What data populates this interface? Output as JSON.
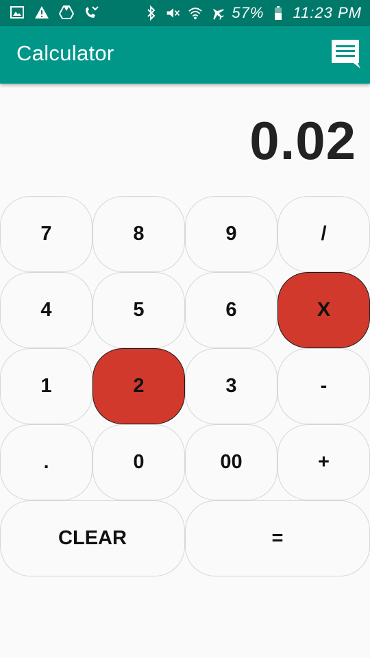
{
  "status_bar": {
    "battery": "57%",
    "time": "11:23 PM",
    "left_icons": [
      "gallery-icon",
      "warning-icon",
      "drive-icon",
      "missed-call-icon"
    ],
    "right_icons": [
      "bluetooth-icon",
      "mute-icon",
      "wifi-icon",
      "airplane-icon",
      "battery-icon"
    ]
  },
  "app_bar": {
    "title": "Calculator",
    "action_icon": "chat-icon"
  },
  "display": {
    "value": "0.02"
  },
  "keys": {
    "row1": [
      "7",
      "8",
      "9",
      "/"
    ],
    "row2": [
      "4",
      "5",
      "6",
      "X"
    ],
    "row3": [
      "1",
      "2",
      "3",
      "-"
    ],
    "row4": [
      ".",
      "0",
      "00",
      "+"
    ],
    "row5": [
      "CLEAR",
      "="
    ]
  },
  "highlighted_keys": [
    "X",
    "2"
  ],
  "colors": {
    "status_bar": "#00796b",
    "app_bar": "#009688",
    "key_highlight": "#d0392b",
    "background": "#fafafa"
  }
}
